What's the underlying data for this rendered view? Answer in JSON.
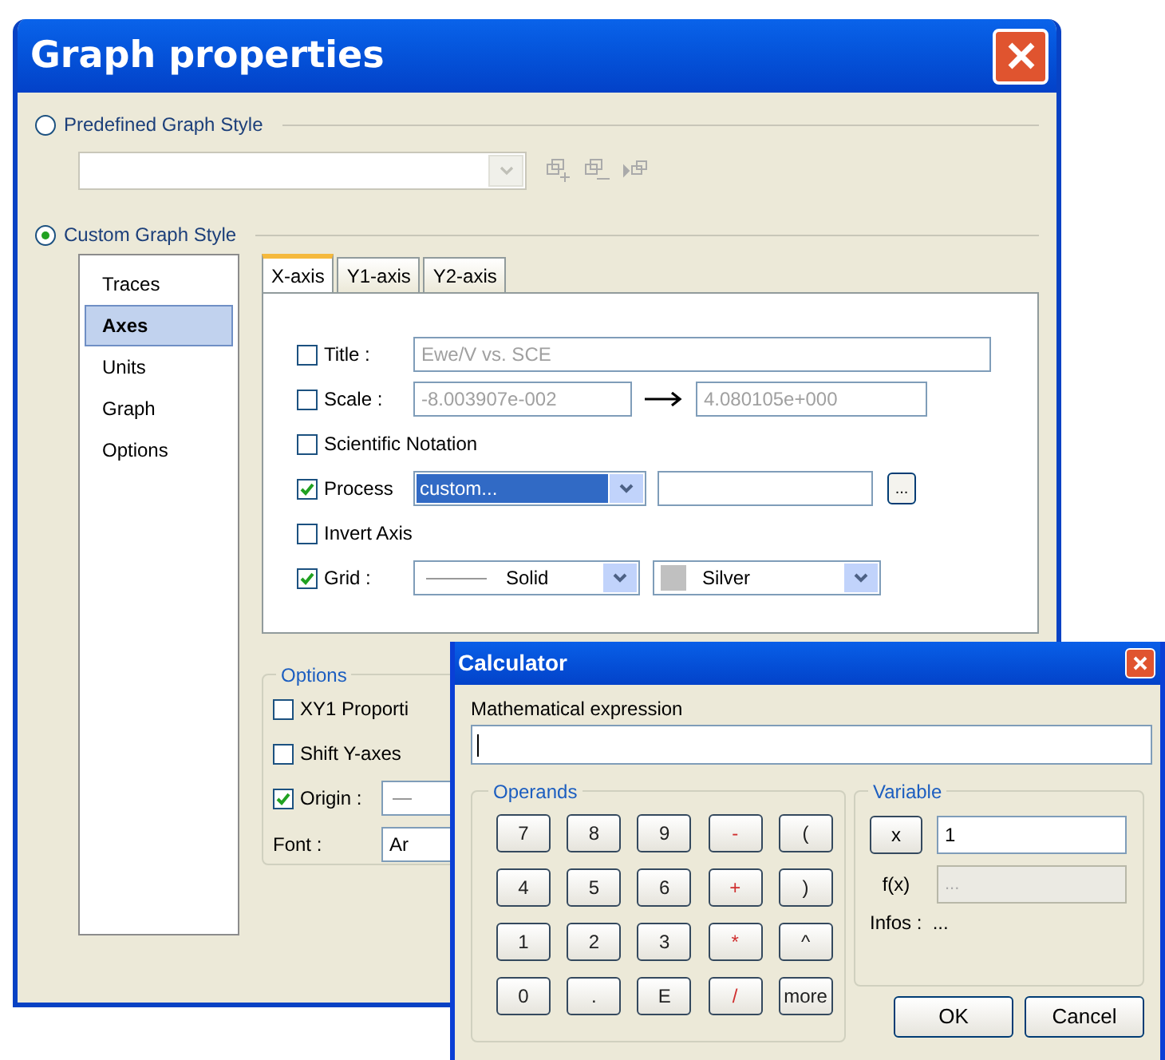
{
  "window": {
    "title": "Graph properties"
  },
  "style_options": [
    {
      "label": "Predefined Graph Style",
      "selected": false
    },
    {
      "label": "Custom Graph Style",
      "selected": true
    }
  ],
  "sidebar": {
    "items": [
      {
        "label": "Traces",
        "selected": false
      },
      {
        "label": "Axes",
        "selected": true
      },
      {
        "label": "Units",
        "selected": false
      },
      {
        "label": "Graph",
        "selected": false
      },
      {
        "label": "Options",
        "selected": false
      }
    ]
  },
  "tabs": [
    {
      "label": "X-axis",
      "selected": true
    },
    {
      "label": "Y1-axis",
      "selected": false
    },
    {
      "label": "Y2-axis",
      "selected": false
    }
  ],
  "axis_fields": [
    {
      "kind": "text",
      "label": "Title :",
      "checked": false,
      "value": "Ewe/V vs. SCE"
    },
    {
      "kind": "range",
      "label": "Scale :",
      "checked": false,
      "from": "-8.003907e-002",
      "to": "4.080105e+000"
    },
    {
      "kind": "check",
      "label": "Scientific Notation",
      "checked": false
    },
    {
      "kind": "process",
      "label": "Process",
      "checked": true,
      "value": "custom...",
      "browse": "..."
    },
    {
      "kind": "check",
      "label": "Invert Axis",
      "checked": false
    },
    {
      "kind": "grid",
      "label": "Grid :",
      "checked": true,
      "line_style": "Solid",
      "line_color": "Silver"
    }
  ],
  "options": {
    "title": "Options",
    "items": [
      {
        "kind": "check",
        "label": "XY1 Proporti",
        "checked": false
      },
      {
        "kind": "check",
        "label": "Shift Y-axes",
        "checked": false
      },
      {
        "kind": "line",
        "label": "Origin :",
        "checked": true
      },
      {
        "kind": "font",
        "label": "Font :",
        "value": "Ar"
      }
    ]
  },
  "calculator": {
    "title": "Calculator",
    "expression_label": "Mathematical expression",
    "operands_title": "Operands",
    "keys": [
      {
        "label": "7",
        "kind": "digit"
      },
      {
        "label": "8",
        "kind": "digit"
      },
      {
        "label": "9",
        "kind": "digit"
      },
      {
        "label": "-",
        "kind": "operator"
      },
      {
        "label": "(",
        "kind": "digit"
      },
      {
        "label": "4",
        "kind": "digit"
      },
      {
        "label": "5",
        "kind": "digit"
      },
      {
        "label": "6",
        "kind": "digit"
      },
      {
        "label": "+",
        "kind": "operator"
      },
      {
        "label": ")",
        "kind": "digit"
      },
      {
        "label": "1",
        "kind": "digit"
      },
      {
        "label": "2",
        "kind": "digit"
      },
      {
        "label": "3",
        "kind": "digit"
      },
      {
        "label": "*",
        "kind": "operator"
      },
      {
        "label": "^",
        "kind": "digit"
      },
      {
        "label": "0",
        "kind": "digit"
      },
      {
        "label": ".",
        "kind": "digit"
      },
      {
        "label": "E",
        "kind": "digit"
      },
      {
        "label": "/",
        "kind": "operator"
      },
      {
        "label": "more",
        "kind": "digit"
      }
    ],
    "variable_title": "Variable",
    "variable_button": "x",
    "variable_value": "1",
    "fx_label": "f(x)",
    "fx_value": "...",
    "infos": "Infos :  ...",
    "buttons": [
      "OK",
      "Cancel"
    ]
  }
}
